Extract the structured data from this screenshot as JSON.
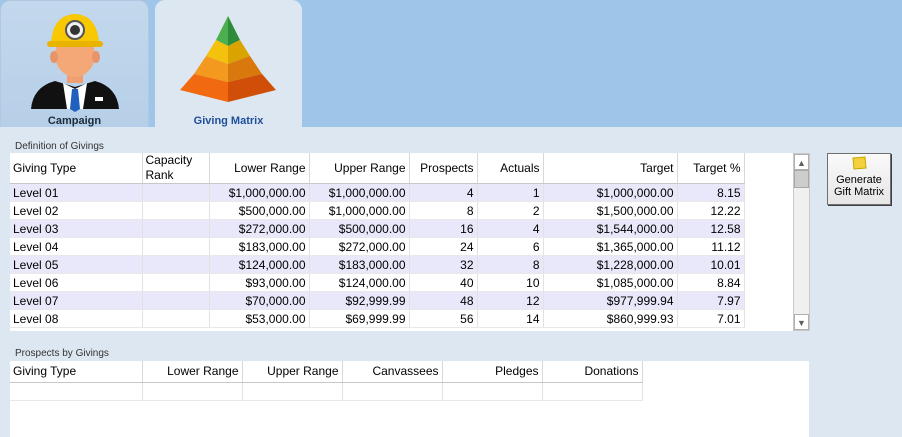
{
  "tabs": [
    {
      "label": "Campaign",
      "icon": "miner-helmet-person-icon"
    },
    {
      "label": "Giving Matrix",
      "icon": "pyramid-icon"
    }
  ],
  "definition": {
    "label": "Definition of Givings",
    "columns": [
      "Giving Type",
      "Capacity Rank",
      "Lower Range",
      "Upper Range",
      "Prospects",
      "Actuals",
      "Target",
      "Target %"
    ],
    "rows": [
      [
        "Level 01",
        "",
        "$1,000,000.00",
        "$1,000,000.00",
        "4",
        "1",
        "$1,000,000.00",
        "8.15"
      ],
      [
        "Level 02",
        "",
        "$500,000.00",
        "$1,000,000.00",
        "8",
        "2",
        "$1,500,000.00",
        "12.22"
      ],
      [
        "Level 03",
        "",
        "$272,000.00",
        "$500,000.00",
        "16",
        "4",
        "$1,544,000.00",
        "12.58"
      ],
      [
        "Level 04",
        "",
        "$183,000.00",
        "$272,000.00",
        "24",
        "6",
        "$1,365,000.00",
        "11.12"
      ],
      [
        "Level 05",
        "",
        "$124,000.00",
        "$183,000.00",
        "32",
        "8",
        "$1,228,000.00",
        "10.01"
      ],
      [
        "Level 06",
        "",
        "$93,000.00",
        "$124,000.00",
        "40",
        "10",
        "$1,085,000.00",
        "8.84"
      ],
      [
        "Level 07",
        "",
        "$70,000.00",
        "$92,999.99",
        "48",
        "12",
        "$977,999.94",
        "7.97"
      ],
      [
        "Level 08",
        "",
        "$53,000.00",
        "$69,999.99",
        "56",
        "14",
        "$860,999.93",
        "7.01"
      ]
    ]
  },
  "generate_button": {
    "label": "Generate Gift Matrix",
    "icon": "sticky-note-icon"
  },
  "prospects": {
    "label": "Prospects by Givings",
    "columns": [
      "Giving Type",
      "Lower Range",
      "Upper Range",
      "Canvassees",
      "Pledges",
      "Donations"
    ]
  },
  "colors": {
    "band": "#9fc5e8",
    "body": "#dde7f1",
    "alt_row": "#e8e8fa",
    "tab_active_text": "#1f4e9a"
  }
}
